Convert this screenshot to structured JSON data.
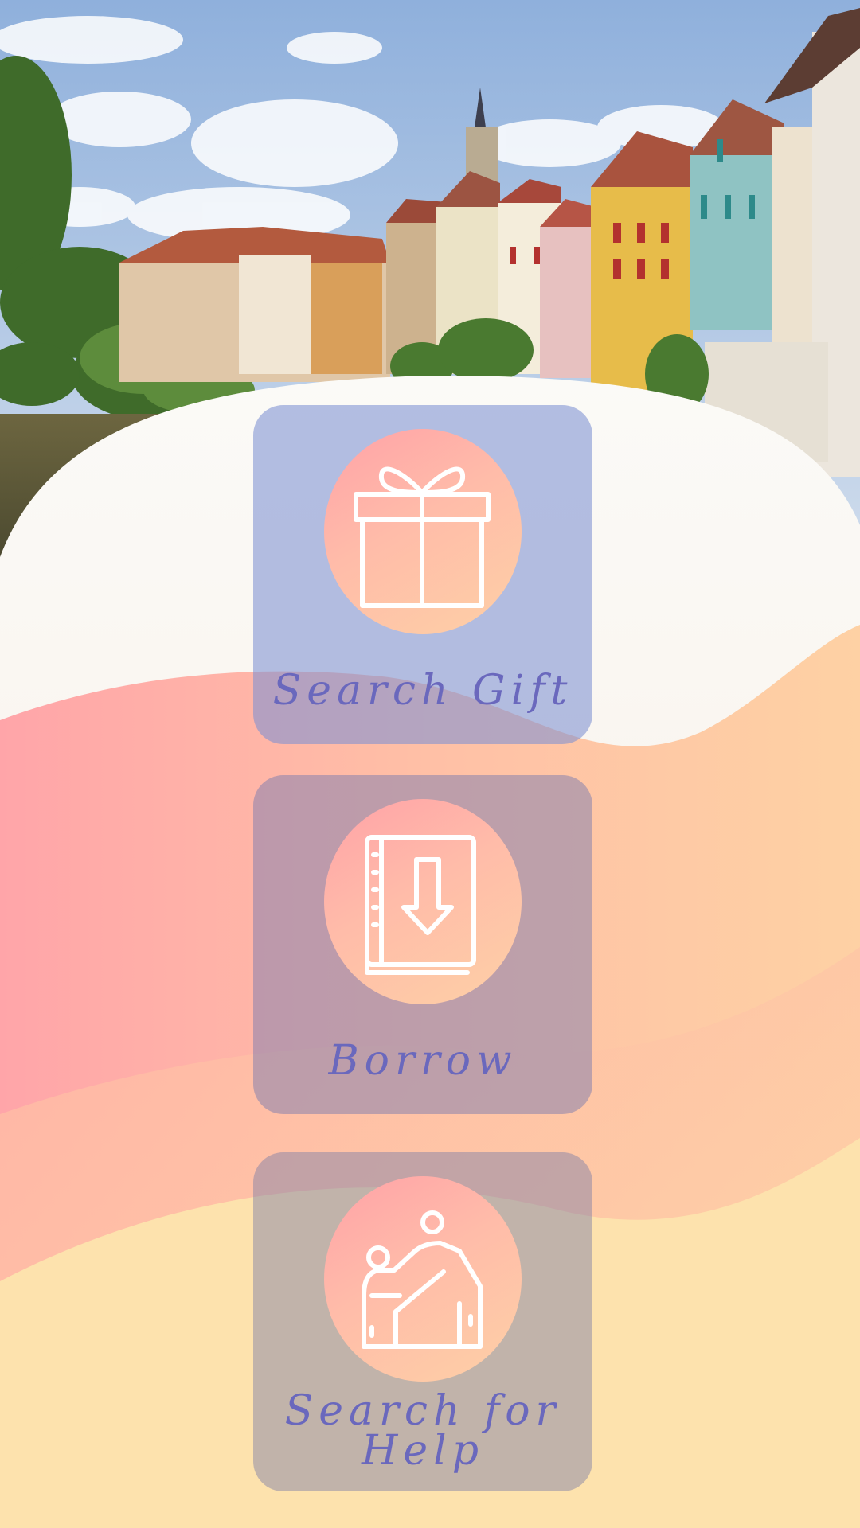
{
  "header_image": {
    "icon": "town-photo"
  },
  "colors": {
    "label": "#6a68bd",
    "circle_gradient": [
      "#ffa2a8",
      "#fed0a6"
    ],
    "background_bottom": "#fde2ad"
  },
  "menu": {
    "search_gift": {
      "label": "Search Gift",
      "icon": "gift-icon"
    },
    "borrow": {
      "label": "Borrow",
      "icon": "book-download-icon"
    },
    "search_help": {
      "label": "Search for Help",
      "icon": "helping-hand-icon"
    }
  }
}
